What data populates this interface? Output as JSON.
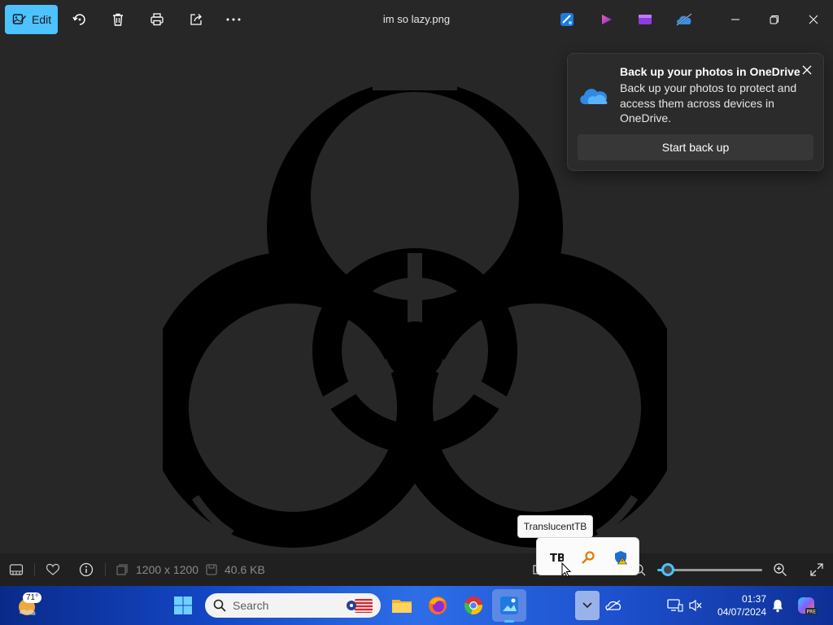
{
  "toolbar": {
    "edit_label": "Edit",
    "icons": [
      "rotate-icon",
      "delete-icon",
      "print-icon",
      "share-icon",
      "more-icon"
    ],
    "file_title": "im so lazy.png",
    "app_icons": [
      "designer-icon",
      "clipchamp-icon",
      "video-icon",
      "onedrive-icon"
    ],
    "window_controls": [
      "minimize-icon",
      "restore-icon",
      "close-icon"
    ]
  },
  "toast": {
    "title": "Back up your photos in OneDrive",
    "body": "Back up your photos to protect and access them across devices in OneDrive.",
    "button": "Start back up"
  },
  "bottombar": {
    "dimensions": "1200 x 1200",
    "file_size": "40.6 KB",
    "zoom_level": 0.1
  },
  "tray": {
    "tooltip": "TranslucentTB",
    "items": [
      "translucenttb-icon",
      "key-icon",
      "defender-warning-icon"
    ]
  },
  "taskbar": {
    "weather_temp": "71°",
    "search_placeholder": "Search",
    "time": "01:37",
    "date": "04/07/2024"
  },
  "colors": {
    "accent": "#4cc2ff",
    "background": "#272727"
  }
}
